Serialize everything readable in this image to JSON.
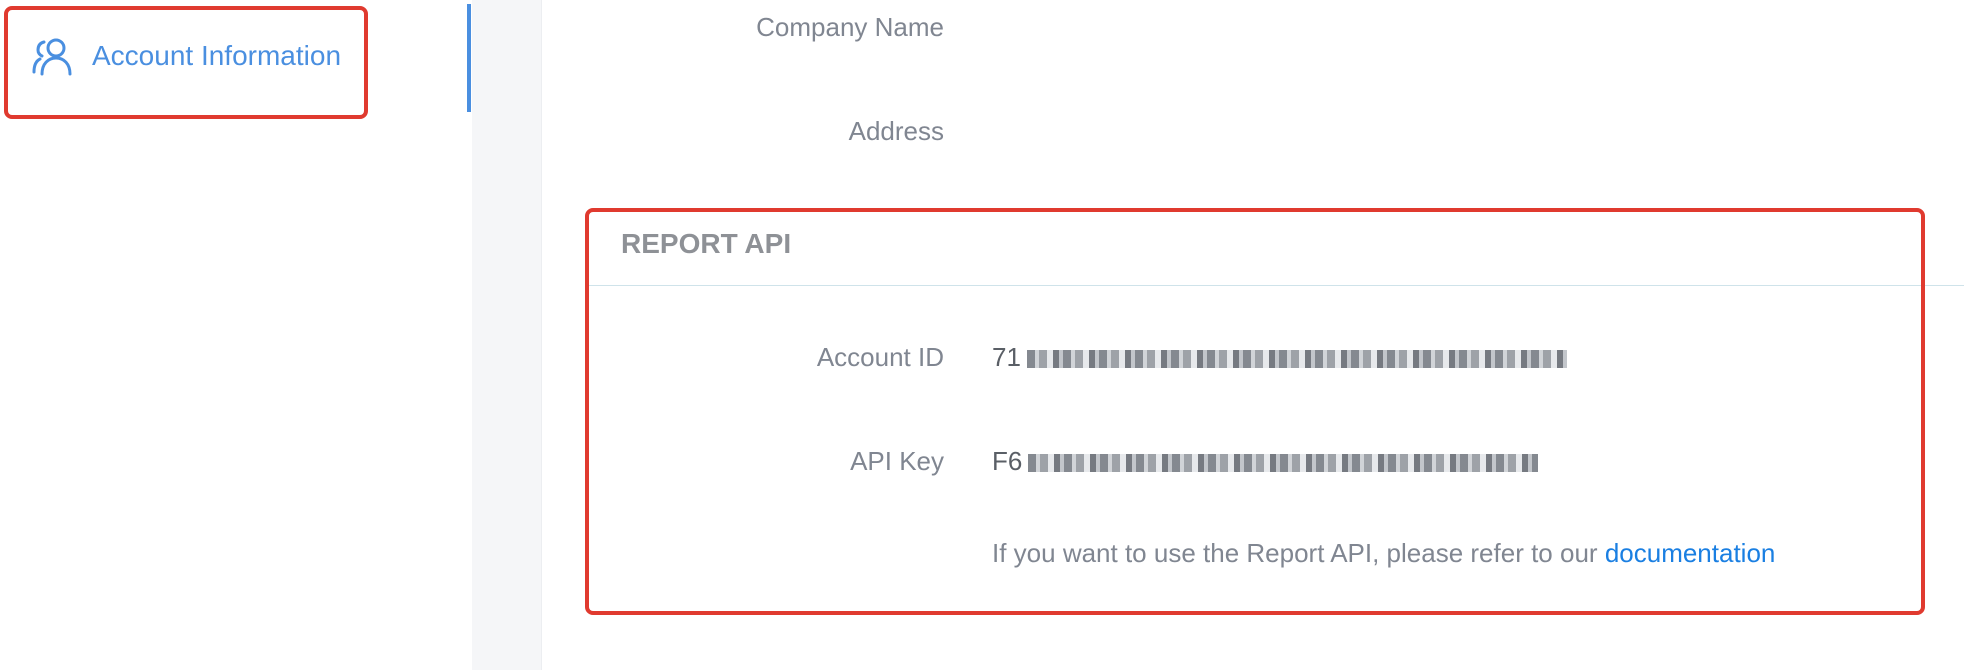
{
  "sidebar": {
    "items": [
      {
        "label": "Account Information",
        "icon": "users-icon",
        "active": true
      }
    ]
  },
  "form": {
    "company_name_label": "Company Name",
    "address_label": "Address"
  },
  "report_api": {
    "title": "REPORT API",
    "account_id_label": "Account ID",
    "account_id_value_visible": "71",
    "api_key_label": "API Key",
    "api_key_value_visible": "F6",
    "help_text": "If you want to use the Report API, please refer to our",
    "doc_link_label": "documentation"
  },
  "colors": {
    "accent": "#4a8fe0",
    "link": "#1a7fe2",
    "highlight": "#e03a2f",
    "label": "#808691"
  }
}
